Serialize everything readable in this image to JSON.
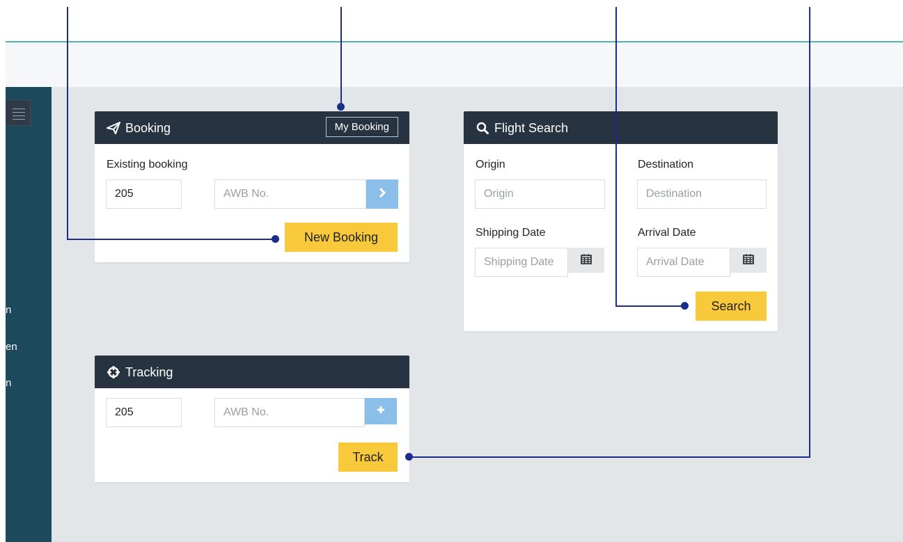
{
  "sidebar": {
    "fragments": [
      "n",
      "en",
      "n"
    ]
  },
  "booking": {
    "title": "Booking",
    "my_booking_label": "My Booking",
    "existing_label": "Existing booking",
    "prefix_value": "205",
    "awb_placeholder": "AWB No.",
    "new_booking_label": "New Booking"
  },
  "flight_search": {
    "title": "Flight Search",
    "origin_label": "Origin",
    "origin_placeholder": "Origin",
    "destination_label": "Destination",
    "destination_placeholder": "Destination",
    "shipping_date_label": "Shipping Date",
    "shipping_date_placeholder": "Shipping Date",
    "arrival_date_label": "Arrival Date",
    "arrival_date_placeholder": "Arrival Date",
    "search_label": "Search"
  },
  "tracking": {
    "title": "Tracking",
    "prefix_value": "205",
    "awb_placeholder": "AWB No.",
    "track_label": "Track"
  },
  "colors": {
    "panel_header": "#283341",
    "accent_yellow": "#f8c93b",
    "go_button": "#8bbfea",
    "sidebar": "#1c4a5c",
    "callout": "#1a2d8a"
  },
  "icons": [
    "hamburger-icon",
    "paper-plane-icon",
    "chevron-right-icon",
    "search-icon",
    "calendar-icon",
    "crosshair-icon",
    "plus-icon"
  ]
}
